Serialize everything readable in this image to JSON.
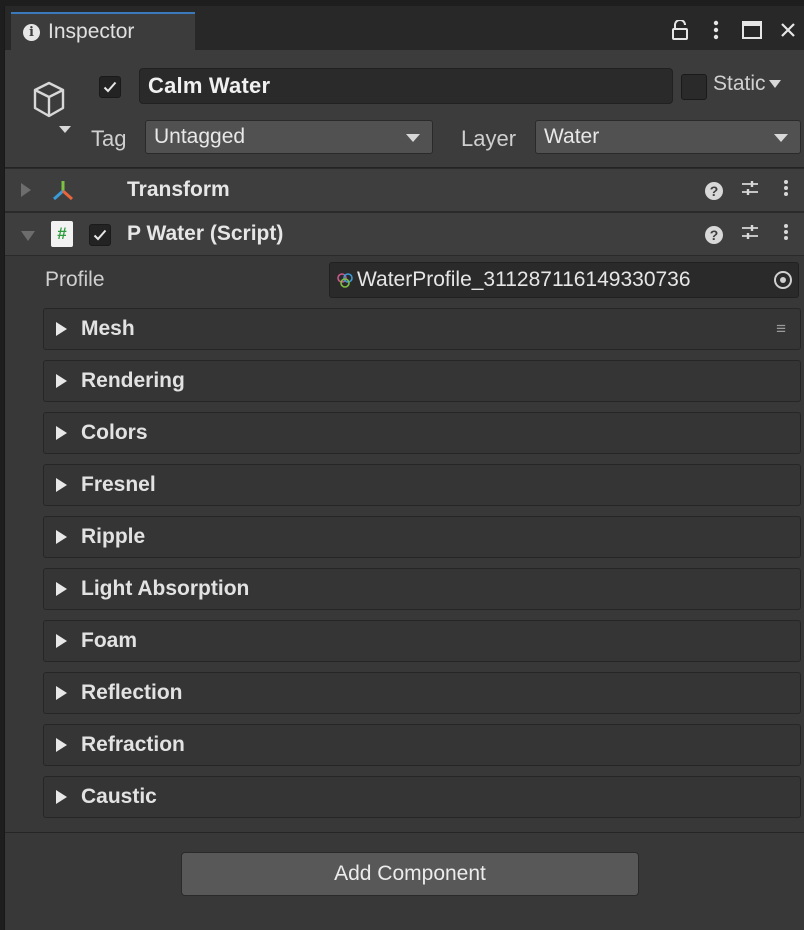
{
  "tab": {
    "label": "Inspector"
  },
  "window_icons": [
    "lock-icon",
    "kebab-menu-icon",
    "maximize-icon",
    "close-icon"
  ],
  "object": {
    "name": "Calm Water",
    "active": true,
    "static_label": "Static",
    "static": false,
    "tag_label": "Tag",
    "tag_value": "Untagged",
    "layer_label": "Layer",
    "layer_value": "Water"
  },
  "components": [
    {
      "title": "Transform",
      "expanded": false
    },
    {
      "title": "P Water (Script)",
      "expanded": true,
      "enabled": true
    }
  ],
  "script": {
    "profile_label": "Profile",
    "profile_value": "WaterProfile_311287116149330736",
    "sections": [
      "Mesh",
      "Rendering",
      "Colors",
      "Fresnel",
      "Ripple",
      "Light Absorption",
      "Foam",
      "Reflection",
      "Refraction",
      "Caustic"
    ]
  },
  "add_component_label": "Add Component",
  "colors": {
    "tab_accent": "#3a79bb",
    "panel_bg": "#383838",
    "script_icon_green": "#2f9b3f"
  }
}
